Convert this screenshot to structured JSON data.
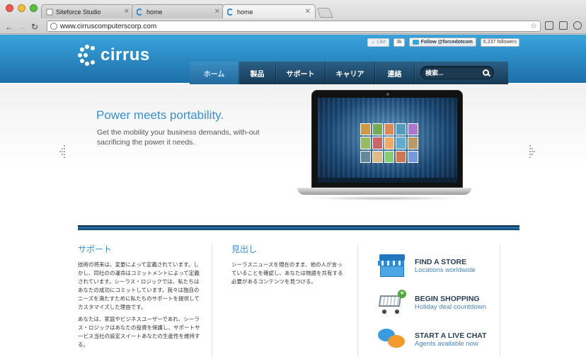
{
  "browser": {
    "tabs": [
      {
        "label": "Siteforce Studio"
      },
      {
        "label": "home"
      },
      {
        "label": "home"
      }
    ],
    "url": "www.cirruscomputerscorp.com"
  },
  "site": {
    "logo_text": "cirrus",
    "social": {
      "like_label": "Like",
      "like_count": "3k",
      "follow_label": "Follow @forcedotcom",
      "followers": "6,237 followers"
    },
    "nav": [
      "ホーム",
      "製品",
      "サポート",
      "キャリア",
      "連絡"
    ],
    "search_placeholder": "検索..."
  },
  "hero": {
    "title": "Power meets portability.",
    "subtitle": "Get the mobility your business demands, with-out sacrificing the power it needs."
  },
  "columns": [
    {
      "title": "サポート",
      "paragraphs": [
        "技術の将来は、変更によって定義されています。しかし、同社のの運命はコミットメントによって定義されています。シーラス・ロジックでは、私たちはあなたの成功にコミットしています。我々は独自のニーズを満たすために私たちのサポートを提供してカスタマイズした理由です。",
        "あなたは、家庭やビジネスユーザーであれ、シーラス・ロジックはあなたの投資を保護し、サポートサービス当社の設定スイートあなたの生産性を維持する。"
      ]
    },
    {
      "title": "見出し",
      "paragraphs": [
        "シーラスニュースを現在のまま、他の人が言っていることを確認し、あなたは物語を共有する必要があるコンテンツを見つける。"
      ]
    }
  ],
  "ctas": [
    {
      "title": "FIND A STORE",
      "subtitle": "Locations worldwide",
      "icon": "store-icon"
    },
    {
      "title": "BEGIN SHOPPING",
      "subtitle": "Holiday deal countdown",
      "icon": "cart-icon"
    },
    {
      "title": "START A LIVE CHAT",
      "subtitle": "Agents available now",
      "icon": "chat-icon"
    }
  ],
  "colors": {
    "brand_blue": "#2b8fd0",
    "nav_dark": "#1f4868",
    "accent_text": "#3b8fcf"
  }
}
